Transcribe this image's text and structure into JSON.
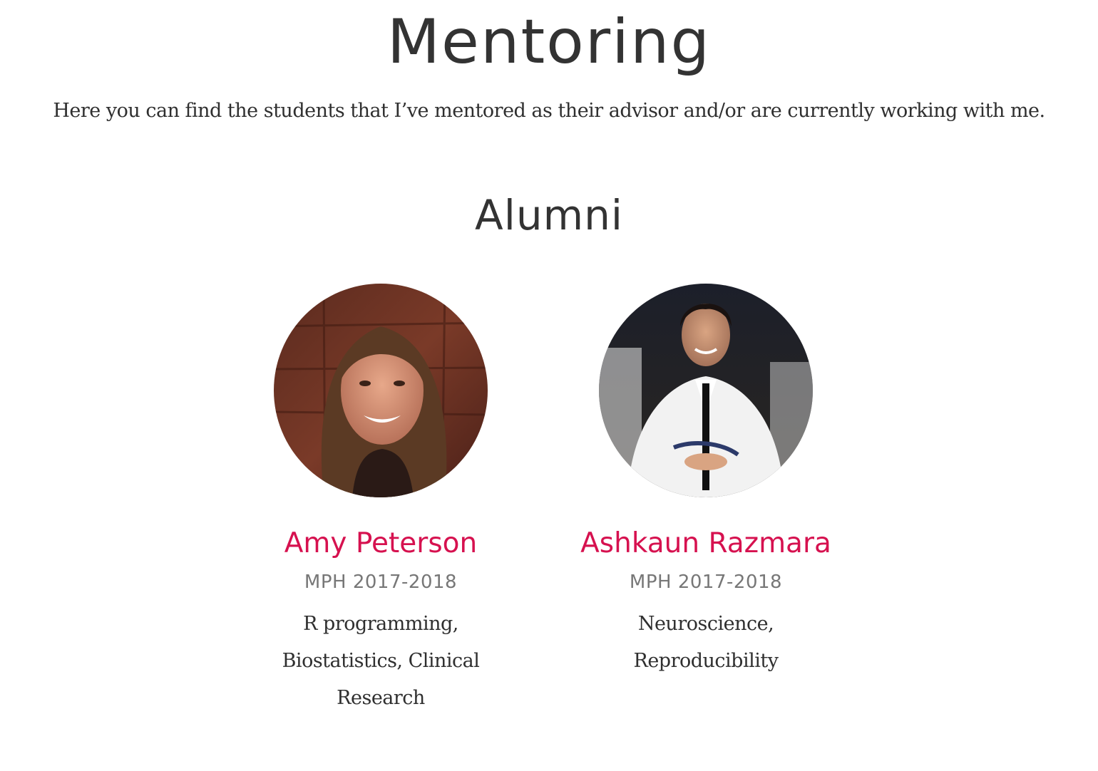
{
  "page": {
    "title": "Mentoring",
    "intro": "Here you can find the students that I’ve mentored as their advisor and/or are currently working with me."
  },
  "alumni": {
    "heading": "Alumni",
    "people": [
      {
        "name": "Amy Peterson",
        "degree": "MPH 2017-2018",
        "interests": "R programming, Biostatistics, Clinical Research"
      },
      {
        "name": "Ashkaun Razmara",
        "degree": "MPH 2017-2018",
        "interests": "Neuroscience, Reproducibility"
      }
    ]
  },
  "colors": {
    "accent": "#d6114f",
    "text": "#333333",
    "muted": "#777777"
  }
}
